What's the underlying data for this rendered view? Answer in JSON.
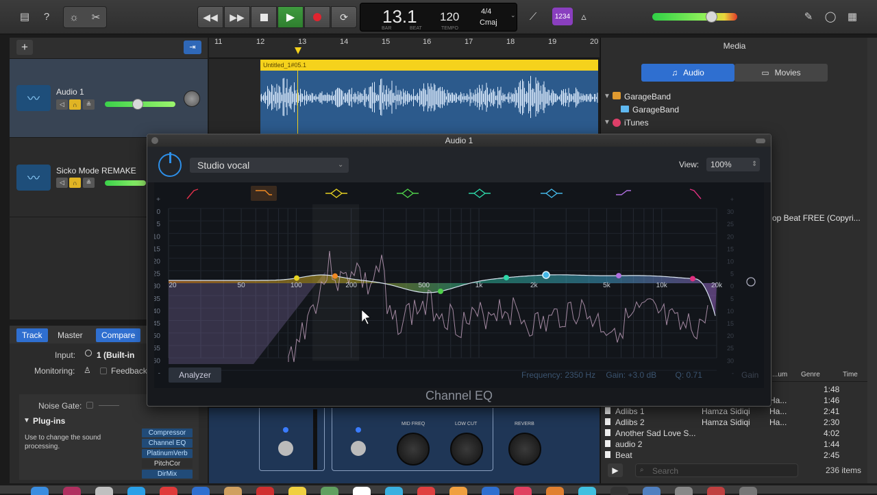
{
  "lcd": {
    "position": "13.1",
    "bar_label": "BAR",
    "beat_label": "BEAT",
    "tempo": "120",
    "tempo_label": "TEMPO",
    "signature": "4/4",
    "key": "Cmaj"
  },
  "count_in": "1234",
  "tracks": [
    {
      "name": "Audio 1"
    },
    {
      "name": "Sicko Mode REMAKE"
    }
  ],
  "ruler": [
    "11",
    "12",
    "13",
    "14",
    "15",
    "16",
    "17",
    "18",
    "19",
    "20"
  ],
  "region_title": "Untitled_1#05.1",
  "media": {
    "title": "Media",
    "tab_audio": "Audio",
    "tab_movies": "Movies",
    "tree": [
      {
        "label": "GarageBand"
      },
      {
        "label": "GarageBand"
      },
      {
        "label": "iTunes"
      }
    ],
    "truncated_item": "op Beat FREE (Copyri...",
    "columns": {
      "album": "...um",
      "genre": "Genre",
      "time": "Time"
    },
    "rows": [
      {
        "name": "",
        "artist": "",
        "album": "",
        "time": "1:48"
      },
      {
        "name": "",
        "artist": "",
        "album": "Ha...",
        "time": "1:46"
      },
      {
        "name": "Adlibs 1",
        "artist": "Hamza Sidiqi",
        "album": "Ha...",
        "time": "2:41"
      },
      {
        "name": "Adlibs 2",
        "artist": "Hamza Sidiqi",
        "album": "Ha...",
        "time": "2:30"
      },
      {
        "name": "Another Sad Love S...",
        "artist": "",
        "album": "",
        "time": "4:02"
      },
      {
        "name": "audio 2",
        "artist": "",
        "album": "",
        "time": "1:44"
      },
      {
        "name": "Beat",
        "artist": "",
        "album": "",
        "time": "2:45"
      }
    ],
    "search_placeholder": "Search",
    "count": "236 items"
  },
  "smart": {
    "tab_track": "Track",
    "tab_master": "Master",
    "tab_compare": "Compare",
    "input_label": "Input:",
    "input_value": "1  (Built-in",
    "monitoring_label": "Monitoring:",
    "feedback_label": "Feedback",
    "noise_gate_label": "Noise Gate:",
    "plugins_label": "Plug-ins",
    "plugins_hint": "Use to change the sound processing.",
    "plugins": [
      "Compressor",
      "Channel EQ",
      "PlatinumVerb",
      "PitchCor",
      "DirMix"
    ]
  },
  "amp": {
    "mid_freq": "MID FREQ",
    "low_cut": "LOW CUT",
    "reverb": "REVERB"
  },
  "eq": {
    "window_title": "Audio 1",
    "preset": "Studio vocal",
    "view_label": "View:",
    "view_value": "100%",
    "analyzer": "Analyzer",
    "frequency_label": "Frequency:",
    "frequency_value": "2350 Hz",
    "gain_label": "Gain:",
    "gain_value": "+3.0 dB",
    "q_label": "Q:",
    "q_value": "0.71",
    "gain_axis_label": "Gain",
    "footer": "Channel EQ",
    "freq_labels": [
      "20",
      "50",
      "100",
      "200",
      "500",
      "1k",
      "2k",
      "5k",
      "10k",
      "20k"
    ],
    "left_scale": [
      "+",
      "0",
      "5",
      "10",
      "15",
      "20",
      "25",
      "30",
      "35",
      "40",
      "45",
      "50",
      "55",
      "60",
      "-"
    ],
    "right_scale": [
      "+",
      "30",
      "25",
      "20",
      "15",
      "10",
      "5",
      "0",
      "5",
      "10",
      "15",
      "20",
      "25",
      "30",
      "-"
    ],
    "band_colors": [
      "#e0304a",
      "#f08a24",
      "#e6d222",
      "#4fd04a",
      "#2ed6a8",
      "#44b8e8",
      "#b070e0",
      "#e03080"
    ]
  }
}
